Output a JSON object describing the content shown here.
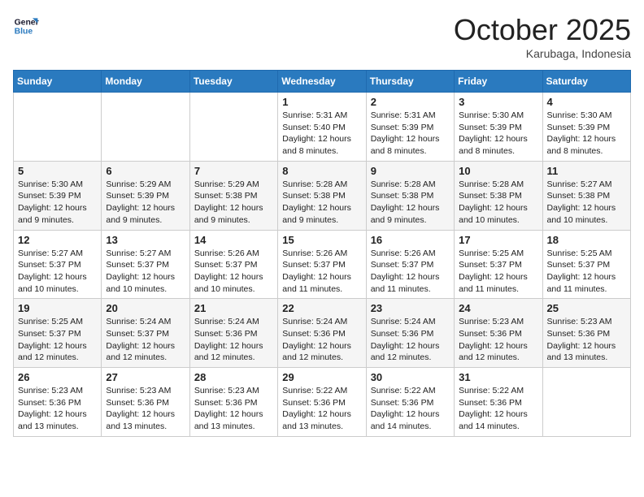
{
  "header": {
    "logo_line1": "General",
    "logo_line2": "Blue",
    "month_title": "October 2025",
    "location": "Karubaga, Indonesia"
  },
  "weekdays": [
    "Sunday",
    "Monday",
    "Tuesday",
    "Wednesday",
    "Thursday",
    "Friday",
    "Saturday"
  ],
  "weeks": [
    [
      {
        "day": "",
        "info": ""
      },
      {
        "day": "",
        "info": ""
      },
      {
        "day": "",
        "info": ""
      },
      {
        "day": "1",
        "info": "Sunrise: 5:31 AM\nSunset: 5:40 PM\nDaylight: 12 hours\nand 8 minutes."
      },
      {
        "day": "2",
        "info": "Sunrise: 5:31 AM\nSunset: 5:39 PM\nDaylight: 12 hours\nand 8 minutes."
      },
      {
        "day": "3",
        "info": "Sunrise: 5:30 AM\nSunset: 5:39 PM\nDaylight: 12 hours\nand 8 minutes."
      },
      {
        "day": "4",
        "info": "Sunrise: 5:30 AM\nSunset: 5:39 PM\nDaylight: 12 hours\nand 8 minutes."
      }
    ],
    [
      {
        "day": "5",
        "info": "Sunrise: 5:30 AM\nSunset: 5:39 PM\nDaylight: 12 hours\nand 9 minutes."
      },
      {
        "day": "6",
        "info": "Sunrise: 5:29 AM\nSunset: 5:39 PM\nDaylight: 12 hours\nand 9 minutes."
      },
      {
        "day": "7",
        "info": "Sunrise: 5:29 AM\nSunset: 5:38 PM\nDaylight: 12 hours\nand 9 minutes."
      },
      {
        "day": "8",
        "info": "Sunrise: 5:28 AM\nSunset: 5:38 PM\nDaylight: 12 hours\nand 9 minutes."
      },
      {
        "day": "9",
        "info": "Sunrise: 5:28 AM\nSunset: 5:38 PM\nDaylight: 12 hours\nand 9 minutes."
      },
      {
        "day": "10",
        "info": "Sunrise: 5:28 AM\nSunset: 5:38 PM\nDaylight: 12 hours\nand 10 minutes."
      },
      {
        "day": "11",
        "info": "Sunrise: 5:27 AM\nSunset: 5:38 PM\nDaylight: 12 hours\nand 10 minutes."
      }
    ],
    [
      {
        "day": "12",
        "info": "Sunrise: 5:27 AM\nSunset: 5:37 PM\nDaylight: 12 hours\nand 10 minutes."
      },
      {
        "day": "13",
        "info": "Sunrise: 5:27 AM\nSunset: 5:37 PM\nDaylight: 12 hours\nand 10 minutes."
      },
      {
        "day": "14",
        "info": "Sunrise: 5:26 AM\nSunset: 5:37 PM\nDaylight: 12 hours\nand 10 minutes."
      },
      {
        "day": "15",
        "info": "Sunrise: 5:26 AM\nSunset: 5:37 PM\nDaylight: 12 hours\nand 11 minutes."
      },
      {
        "day": "16",
        "info": "Sunrise: 5:26 AM\nSunset: 5:37 PM\nDaylight: 12 hours\nand 11 minutes."
      },
      {
        "day": "17",
        "info": "Sunrise: 5:25 AM\nSunset: 5:37 PM\nDaylight: 12 hours\nand 11 minutes."
      },
      {
        "day": "18",
        "info": "Sunrise: 5:25 AM\nSunset: 5:37 PM\nDaylight: 12 hours\nand 11 minutes."
      }
    ],
    [
      {
        "day": "19",
        "info": "Sunrise: 5:25 AM\nSunset: 5:37 PM\nDaylight: 12 hours\nand 12 minutes."
      },
      {
        "day": "20",
        "info": "Sunrise: 5:24 AM\nSunset: 5:37 PM\nDaylight: 12 hours\nand 12 minutes."
      },
      {
        "day": "21",
        "info": "Sunrise: 5:24 AM\nSunset: 5:36 PM\nDaylight: 12 hours\nand 12 minutes."
      },
      {
        "day": "22",
        "info": "Sunrise: 5:24 AM\nSunset: 5:36 PM\nDaylight: 12 hours\nand 12 minutes."
      },
      {
        "day": "23",
        "info": "Sunrise: 5:24 AM\nSunset: 5:36 PM\nDaylight: 12 hours\nand 12 minutes."
      },
      {
        "day": "24",
        "info": "Sunrise: 5:23 AM\nSunset: 5:36 PM\nDaylight: 12 hours\nand 12 minutes."
      },
      {
        "day": "25",
        "info": "Sunrise: 5:23 AM\nSunset: 5:36 PM\nDaylight: 12 hours\nand 13 minutes."
      }
    ],
    [
      {
        "day": "26",
        "info": "Sunrise: 5:23 AM\nSunset: 5:36 PM\nDaylight: 12 hours\nand 13 minutes."
      },
      {
        "day": "27",
        "info": "Sunrise: 5:23 AM\nSunset: 5:36 PM\nDaylight: 12 hours\nand 13 minutes."
      },
      {
        "day": "28",
        "info": "Sunrise: 5:23 AM\nSunset: 5:36 PM\nDaylight: 12 hours\nand 13 minutes."
      },
      {
        "day": "29",
        "info": "Sunrise: 5:22 AM\nSunset: 5:36 PM\nDaylight: 12 hours\nand 13 minutes."
      },
      {
        "day": "30",
        "info": "Sunrise: 5:22 AM\nSunset: 5:36 PM\nDaylight: 12 hours\nand 14 minutes."
      },
      {
        "day": "31",
        "info": "Sunrise: 5:22 AM\nSunset: 5:36 PM\nDaylight: 12 hours\nand 14 minutes."
      },
      {
        "day": "",
        "info": ""
      }
    ]
  ]
}
